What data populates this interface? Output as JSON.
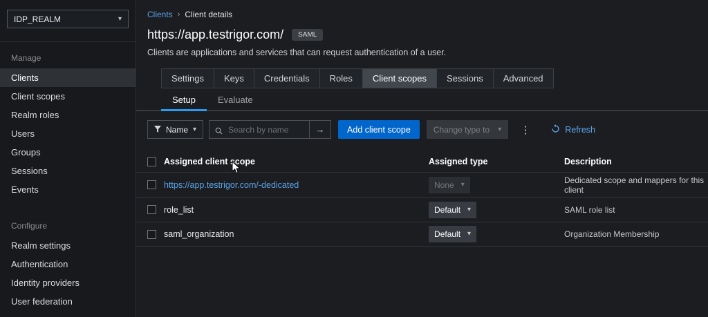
{
  "colors": {
    "accent": "#0066cc",
    "link": "#5ba3e8",
    "tab_underline": "#2b9af3",
    "bg": "#1b1d21",
    "sidebar_bg": "#17191d"
  },
  "icons": {
    "caret": "▾",
    "kebab": "⋮",
    "arrow": "→",
    "breadcrumb_separator": "›"
  },
  "sidebar": {
    "realm_selector": "IDP_REALM",
    "sections": [
      {
        "label": "Manage",
        "items": [
          "Clients",
          "Client scopes",
          "Realm roles",
          "Users",
          "Groups",
          "Sessions",
          "Events"
        ]
      },
      {
        "label": "Configure",
        "items": [
          "Realm settings",
          "Authentication",
          "Identity providers",
          "User federation"
        ]
      }
    ],
    "selected_item": "Clients"
  },
  "breadcrumb": {
    "parent": "Clients",
    "current": "Client details"
  },
  "header": {
    "title": "https://app.testrigor.com/",
    "badge": "SAML",
    "description": "Clients are applications and services that can request authentication of a user."
  },
  "tabs": {
    "items": [
      "Settings",
      "Keys",
      "Credentials",
      "Roles",
      "Client scopes",
      "Sessions",
      "Advanced"
    ],
    "active": "Client scopes"
  },
  "subtabs": {
    "items": [
      "Setup",
      "Evaluate"
    ],
    "active": "Setup"
  },
  "toolbar": {
    "filter_label": "Name",
    "search_placeholder": "Search by name",
    "add_button": "Add client scope",
    "change_type_label": "Change type to",
    "refresh_label": "Refresh"
  },
  "table": {
    "columns": [
      "Assigned client scope",
      "Assigned type",
      "Description"
    ],
    "rows": [
      {
        "name": "https://app.testrigor.com/-dedicated",
        "is_link": true,
        "type": "None",
        "type_disabled": true,
        "description": "Dedicated scope and mappers for this client"
      },
      {
        "name": "role_list",
        "is_link": false,
        "type": "Default",
        "type_disabled": false,
        "description": "SAML role list"
      },
      {
        "name": "saml_organization",
        "is_link": false,
        "type": "Default",
        "type_disabled": false,
        "description": "Organization Membership"
      }
    ]
  }
}
